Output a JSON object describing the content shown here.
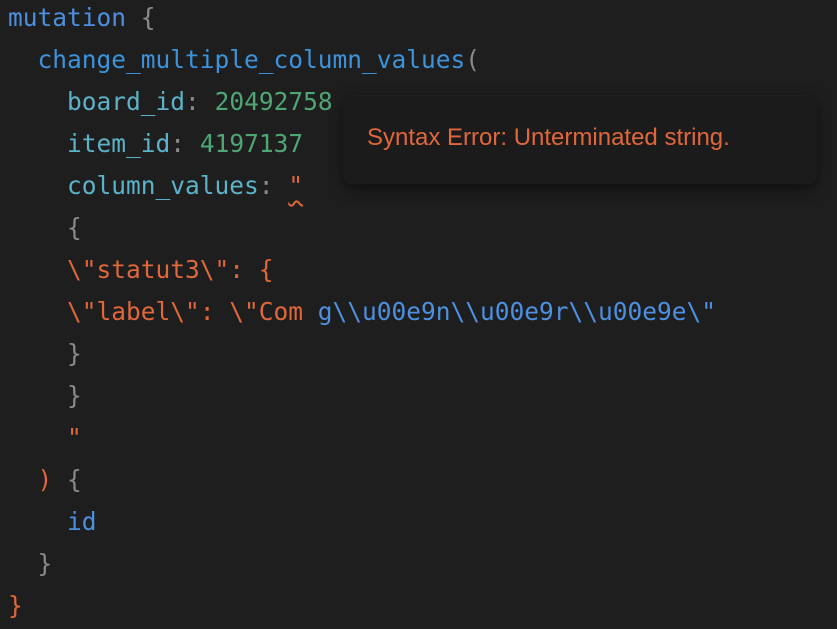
{
  "code": {
    "line1": {
      "keyword": "mutation",
      "brace": "{"
    },
    "line2": {
      "function": "change_multiple_column_values",
      "paren": "("
    },
    "line3": {
      "name": "board_id",
      "colon": ":",
      "value": "20492758"
    },
    "line4": {
      "name": "item_id",
      "colon": ":",
      "value": "4197137"
    },
    "line5": {
      "name": "column_values",
      "colon": ":",
      "quote": "\""
    },
    "line6": {
      "text": "{"
    },
    "line7": {
      "text": "\\\"statut3\\\": {"
    },
    "line8": {
      "part1": "\\\"label\\\": \\\"Com ",
      "part2": "g\\\\u00e9n\\\\u00e9r\\\\u00e9e\\\""
    },
    "line9": {
      "text": "}"
    },
    "line10": {
      "text": "}"
    },
    "line11": {
      "text": "\""
    },
    "line12": {
      "paren": ")",
      "brace": "{"
    },
    "line13": {
      "field": "id"
    },
    "line14": {
      "brace": "}"
    },
    "line15": {
      "brace": "}"
    }
  },
  "error_tooltip": {
    "message": "Syntax Error: Unterminated string."
  },
  "colors": {
    "background": "#1e1e1e",
    "keyword": "#4d8fe0",
    "argument": "#5bb2c9",
    "number": "#4fa574",
    "string": "#e0673b",
    "punctuation": "#8a8a8a",
    "error": "#e0673b"
  }
}
